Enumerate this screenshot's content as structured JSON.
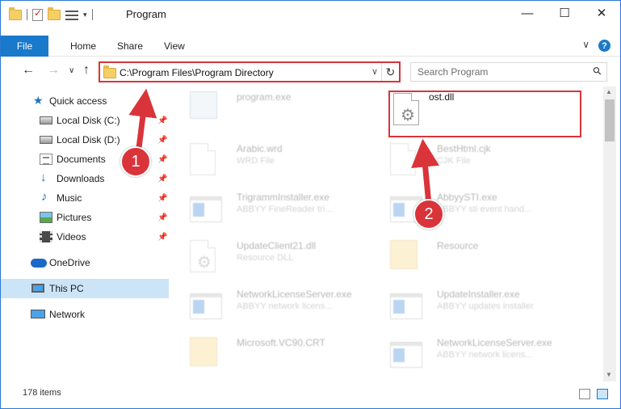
{
  "window": {
    "title": "Program",
    "minimize": "—",
    "maximize": "☐",
    "close": "✕"
  },
  "ribbon": {
    "tabs": [
      "File",
      "Home",
      "Share",
      "View"
    ],
    "help": "?",
    "collapse": "∨"
  },
  "nav": {
    "back": "←",
    "forward": "→",
    "recent": "∨",
    "up": "↑",
    "address": "C:\\Program Files\\Program Directory",
    "address_dropdown": "∨",
    "refresh": "↻",
    "search_placeholder": "Search Program",
    "search_icon": "⚲"
  },
  "sidebar": {
    "items": [
      {
        "label": "Quick access",
        "icon": "star-icon",
        "pinned": false
      },
      {
        "label": "Local Disk (C:)",
        "icon": "drive-icon",
        "pinned": true
      },
      {
        "label": "Local Disk (D:)",
        "icon": "drive-icon",
        "pinned": true
      },
      {
        "label": "Documents",
        "icon": "documents-icon",
        "pinned": true
      },
      {
        "label": "Downloads",
        "icon": "downloads-icon",
        "pinned": true
      },
      {
        "label": "Music",
        "icon": "music-icon",
        "pinned": true
      },
      {
        "label": "Pictures",
        "icon": "pictures-icon",
        "pinned": true
      },
      {
        "label": "Videos",
        "icon": "videos-icon",
        "pinned": true
      },
      {
        "label": "OneDrive",
        "icon": "onedrive-icon",
        "pinned": false
      },
      {
        "label": "This PC",
        "icon": "this-pc-icon",
        "pinned": false,
        "selected": true
      },
      {
        "label": "Network",
        "icon": "network-icon",
        "pinned": false
      }
    ],
    "pin_glyph": "📌"
  },
  "files": [
    {
      "name": "program.exe",
      "desc": "",
      "icon": "program-icon",
      "faded": true
    },
    {
      "name": "ost.dll",
      "desc": "",
      "icon": "dll-icon",
      "faded": false,
      "highlighted": true
    },
    {
      "name": "Arabic.wrd",
      "desc": "WRD File",
      "icon": "document-icon",
      "faded": true
    },
    {
      "name": "BestHtml.cjk",
      "desc": "CJK File",
      "icon": "document-icon",
      "faded": true
    },
    {
      "name": "TrigrammInstaller.exe",
      "desc": "ABBYY FineReader tri...",
      "icon": "exe-icon",
      "faded": true
    },
    {
      "name": "AbbyySTI.exe",
      "desc": "ABBYY sti event hand...",
      "icon": "exe-icon",
      "faded": true
    },
    {
      "name": "UpdateClient21.dll",
      "desc": "Resource DLL",
      "icon": "dll-icon",
      "faded": true
    },
    {
      "name": "Resource",
      "desc": "",
      "icon": "folder-icon",
      "faded": true
    },
    {
      "name": "NetworkLicenseServer.exe",
      "desc": "ABBYY network licens...",
      "icon": "exe-icon",
      "faded": true
    },
    {
      "name": "UpdateInstaller.exe",
      "desc": "ABBYY updates installer",
      "icon": "exe-icon",
      "faded": true
    },
    {
      "name": "Microsoft.VC90.CRT",
      "desc": "",
      "icon": "folder-icon",
      "faded": true
    },
    {
      "name": "NetworkLicenseServer.exe",
      "desc": "ABBYY network licens...",
      "icon": "exe-icon",
      "faded": true
    }
  ],
  "callouts": [
    "1",
    "2"
  ],
  "status": {
    "item_count": "178 items"
  },
  "colors": {
    "accent": "#1979ca",
    "highlight_border": "#d9343a",
    "callout_fill": "#d9343a",
    "selected_bg": "#cce4f7"
  }
}
